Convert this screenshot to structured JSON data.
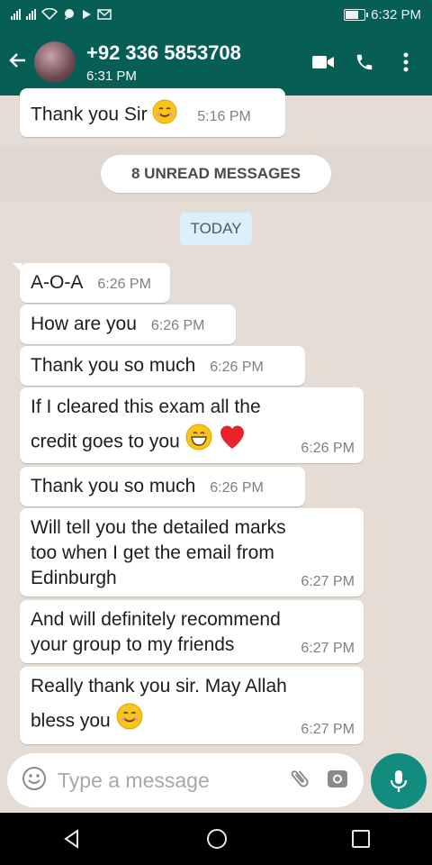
{
  "status_bar": {
    "time": "6:32 PM"
  },
  "header": {
    "contact_name": "+92 336 5853708",
    "last_seen": "6:31 PM",
    "icons": [
      "back-arrow",
      "video-call",
      "voice-call",
      "more-options"
    ]
  },
  "chat": {
    "first_message": {
      "text": "Thank you Sir",
      "time": "5:16 PM"
    },
    "unread_banner": "8 UNREAD MESSAGES",
    "date_chip": "TODAY",
    "messages": [
      {
        "text": "A-O-A",
        "time": "6:26 PM"
      },
      {
        "text": "How are you",
        "time": "6:26 PM"
      },
      {
        "text": "Thank you so much",
        "time": "6:26 PM"
      },
      {
        "line1": "If I cleared this exam all the",
        "line2": "credit goes to you",
        "time": "6:26 PM"
      },
      {
        "text": "Thank you so much",
        "time": "6:26 PM"
      },
      {
        "line1": "Will tell you the detailed marks",
        "line2": "too when I get the email from",
        "line3": "Edinburgh",
        "time": "6:27 PM"
      },
      {
        "line1": "And will definitely recommend",
        "line2": "your group to my friends",
        "time": "6:27 PM"
      },
      {
        "line1": "Really thank you sir. May Allah",
        "line2": "bless you",
        "time": "6:27 PM"
      }
    ]
  },
  "composer": {
    "placeholder": "Type a message"
  },
  "colors": {
    "header": "#075e54",
    "accent": "#128c7e",
    "background": "#e5ddd5"
  }
}
